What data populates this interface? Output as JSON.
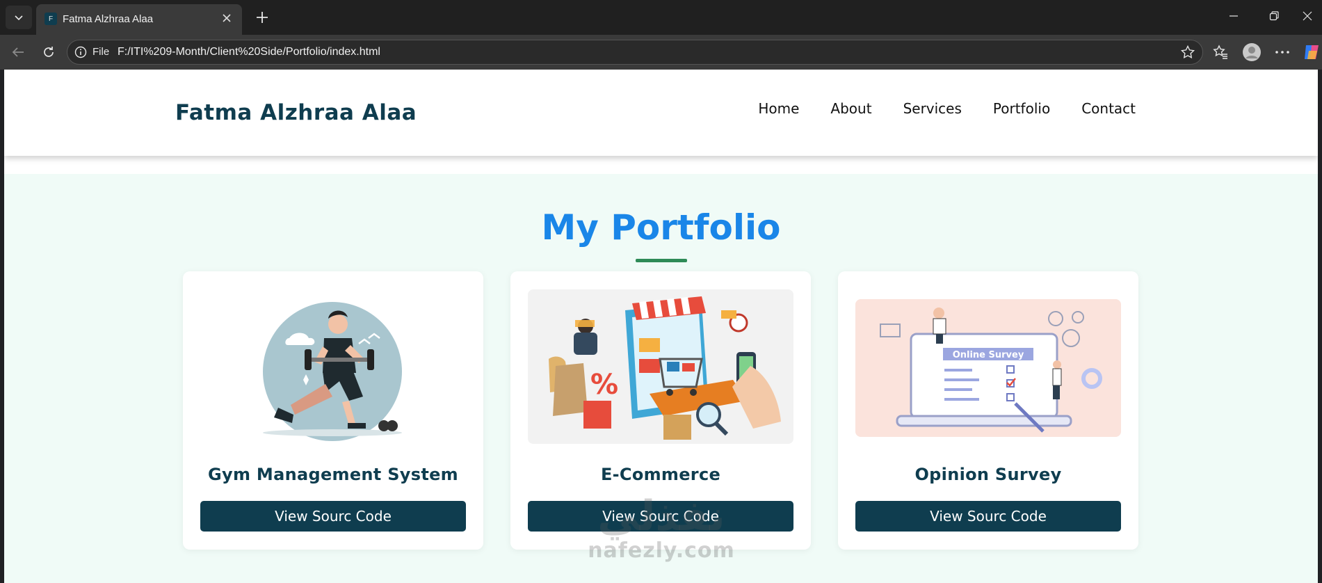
{
  "browser": {
    "tab_title": "Fatma Alzhraa Alaa",
    "tab_favicon_letter": "F",
    "address_scheme": "File",
    "url": "F:/ITI%209-Month/Client%20Side/Portfolio/index.html"
  },
  "site": {
    "brand": "Fatma Alzhraa Alaa",
    "nav": [
      "Home",
      "About",
      "Services",
      "Portfolio",
      "Contact"
    ]
  },
  "portfolio": {
    "title": "My Portfolio",
    "projects": [
      {
        "title": "Gym Management System",
        "button": "View Sourc Code"
      },
      {
        "title": "E-Commerce",
        "button": "View Sourc Code"
      },
      {
        "title": "Opinion Survey",
        "button": "View Sourc Code",
        "image_text": "Online Survey"
      }
    ]
  },
  "watermark": {
    "arabic": "نفذلي",
    "latin": "nafezly.com"
  },
  "colors": {
    "brand": "#0f3d4f",
    "title": "#1a86e8",
    "underline": "#2e8b57",
    "page_bg": "#f0fbf7",
    "button_bg": "#0f3d4f"
  },
  "icons": [
    "tab-list-icon",
    "close-icon",
    "plus-icon",
    "minimize-icon",
    "restore-icon",
    "close-window-icon",
    "back-icon",
    "reload-icon",
    "info-icon",
    "star-icon",
    "favorites-icon",
    "profile-icon",
    "more-icon",
    "copilot-icon"
  ]
}
